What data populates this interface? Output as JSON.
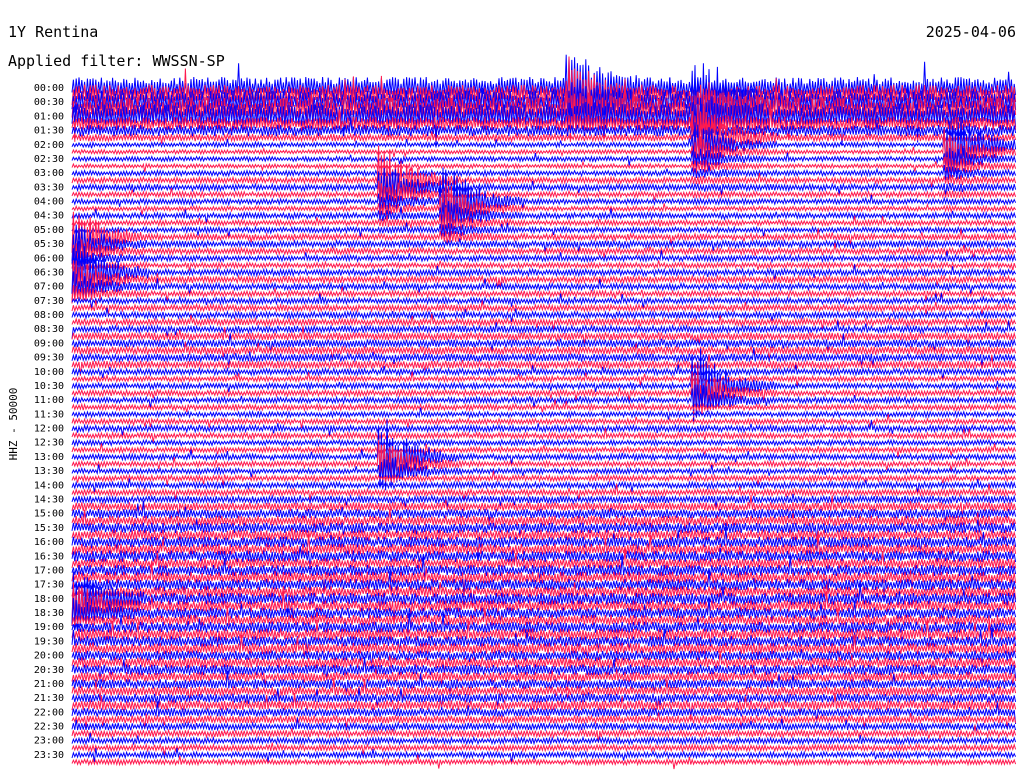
{
  "header": {
    "station": "1Y Rentina",
    "date": "2025-04-06",
    "filter_text": "Applied filter: WWSSN-SP"
  },
  "colors": {
    "trace_a": "#0000ff",
    "trace_b": "#ff1a4f",
    "text": "#000000",
    "background": "#ffffff"
  },
  "chart_data": {
    "type": "helicorder",
    "title": "1Y Rentina",
    "date": "2025-04-06",
    "subtitle": "Applied filter: WWSSN-SP",
    "ylabel": "HHZ - 50000",
    "xlabel": "",
    "row_interval_minutes": 15,
    "labeled_every_rows": 2,
    "row_labels": [
      "00:00",
      "00:30",
      "01:00",
      "01:30",
      "02:00",
      "02:30",
      "03:00",
      "03:30",
      "04:00",
      "04:30",
      "05:00",
      "05:30",
      "06:00",
      "06:30",
      "07:00",
      "07:30",
      "08:00",
      "08:30",
      "09:00",
      "09:30",
      "10:00",
      "10:30",
      "11:00",
      "11:30",
      "12:00",
      "12:30",
      "13:00",
      "13:30",
      "14:00",
      "14:30",
      "15:00",
      "15:30",
      "16:00",
      "16:30",
      "17:00",
      "17:30",
      "18:00",
      "18:30",
      "19:00",
      "19:30",
      "20:00",
      "20:30",
      "21:00",
      "21:30",
      "22:00",
      "22:30",
      "23:00",
      "23:30"
    ],
    "trace_colors": [
      "#0000ff",
      "#ff1a4f"
    ],
    "activity_by_row": [
      4.2,
      4.0,
      4.4,
      4.5,
      4.6,
      2.6,
      2.2,
      1.4,
      0.9,
      0.8,
      0.9,
      0.8,
      1.0,
      1.1,
      1.2,
      1.0,
      1.0,
      0.9,
      1.1,
      1.0,
      1.0,
      1.2,
      1.3,
      1.2,
      1.1,
      1.0,
      1.2,
      1.3,
      1.2,
      1.1,
      1.1,
      1.2,
      1.2,
      1.3,
      1.3,
      1.5,
      1.5,
      1.6,
      1.5,
      1.5,
      1.2,
      1.0,
      1.1,
      1.1,
      1.1,
      1.1,
      1.0,
      1.0,
      1.2,
      1.1,
      1.0,
      1.0,
      1.1,
      1.0,
      1.0,
      1.1,
      1.2,
      1.2,
      1.4,
      1.7,
      1.8,
      1.9,
      2.0,
      2.0,
      2.1,
      2.1,
      2.2,
      2.0,
      2.1,
      2.2,
      2.2,
      2.1,
      2.3,
      2.2,
      2.1,
      2.0,
      2.1,
      2.2,
      2.0,
      2.1,
      1.9,
      2.0,
      2.0,
      1.9,
      1.8,
      1.8,
      1.7,
      1.9,
      1.6,
      1.5,
      1.4,
      1.3,
      1.2,
      1.2,
      1.1,
      1.0
    ],
    "events": [
      {
        "time": "00:08",
        "rows_affected": 6
      },
      {
        "time": "00:40",
        "rows_affected": 4
      },
      {
        "time": "01:55",
        "rows_affected": 10
      },
      {
        "time": "02:14",
        "rows_affected": 12
      },
      {
        "time": "03:20",
        "rows_affected": 8
      },
      {
        "time": "04:06",
        "rows_affected": 6
      },
      {
        "time": "05:15",
        "rows_affected": 6
      },
      {
        "time": "06:30",
        "rows_affected": 4
      },
      {
        "time": "10:40",
        "rows_affected": 3
      },
      {
        "time": "13:05",
        "rows_affected": 3
      },
      {
        "time": "18:00",
        "rows_affected": 3
      }
    ]
  }
}
